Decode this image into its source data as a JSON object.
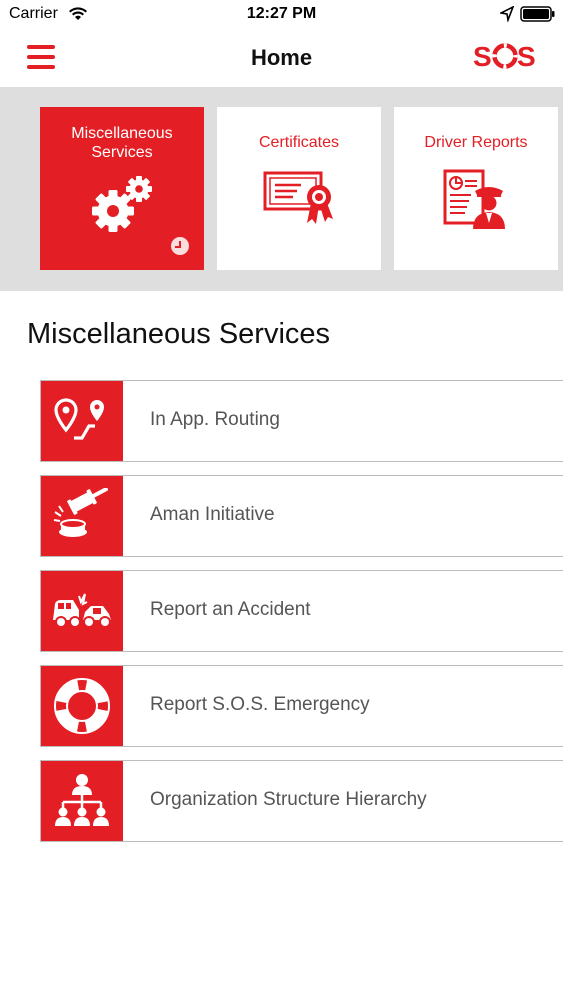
{
  "status_bar": {
    "carrier": "Carrier",
    "time": "12:27 PM"
  },
  "nav": {
    "title": "Home",
    "logo": "SOS"
  },
  "tiles": [
    {
      "label": "Miscellaneous Services",
      "icon": "gears-icon",
      "active": true
    },
    {
      "label": "Certificates",
      "icon": "certificate-icon",
      "active": false
    },
    {
      "label": "Driver Reports",
      "icon": "driver-report-icon",
      "active": false
    }
  ],
  "section": {
    "title": "Miscellaneous Services"
  },
  "services": [
    {
      "label": "In App. Routing",
      "icon": "routing-pins-icon"
    },
    {
      "label": "Aman Initiative",
      "icon": "gavel-icon"
    },
    {
      "label": "Report an Accident",
      "icon": "car-accident-icon"
    },
    {
      "label": "Report S.O.S. Emergency",
      "icon": "lifebuoy-icon"
    },
    {
      "label": "Organization Structure Hierarchy",
      "icon": "org-chart-icon"
    }
  ],
  "colors": {
    "accent": "#e31e24",
    "tile_bg": "#dedede",
    "text_muted": "#555555"
  }
}
